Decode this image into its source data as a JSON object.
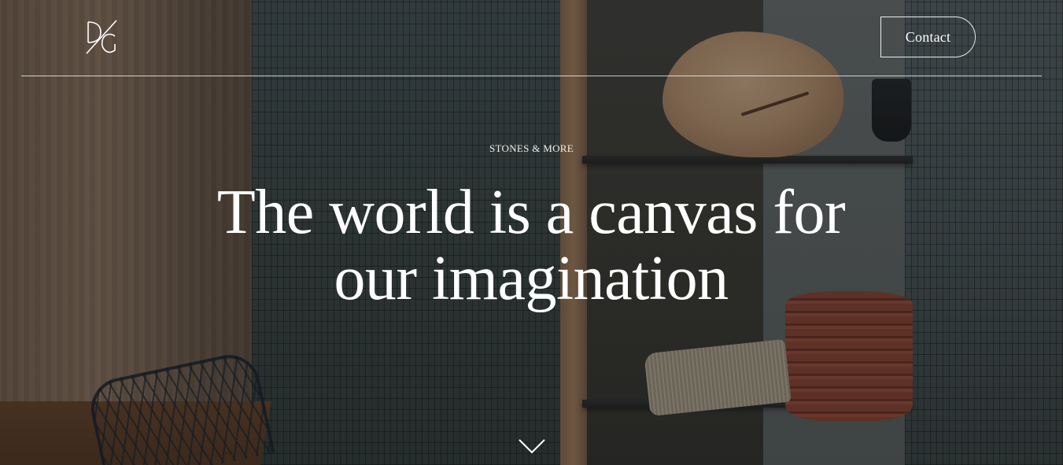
{
  "header": {
    "logo_text": "DG",
    "contact_label": "Contact"
  },
  "hero": {
    "eyebrow": "STONES & MORE",
    "title_line1": "The world is a canvas for",
    "title_line2": "our imagination"
  },
  "icons": {
    "logo": "dg-monogram-icon",
    "scroll": "chevron-down-icon"
  },
  "colors": {
    "text": "#ffffff",
    "overlay": "#141616"
  }
}
